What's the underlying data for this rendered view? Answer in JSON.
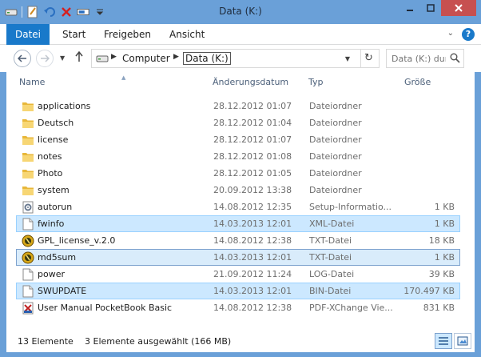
{
  "window": {
    "title": "Data (K:)"
  },
  "ribbon": {
    "tabs": [
      {
        "label": "Datei"
      },
      {
        "label": "Start"
      },
      {
        "label": "Freigeben"
      },
      {
        "label": "Ansicht"
      }
    ],
    "help": "?"
  },
  "address": {
    "crumbs": [
      "Computer",
      "Data (K:)"
    ],
    "search_placeholder": "Data (K:) durc..."
  },
  "columns": {
    "name": "Name",
    "date": "Änderungsdatum",
    "type": "Typ",
    "size": "Größe"
  },
  "files": [
    {
      "name": "applications",
      "date": "28.12.2012 01:07",
      "type": "Dateiordner",
      "size": "",
      "icon": "folder-icon",
      "selected": false
    },
    {
      "name": "Deutsch",
      "date": "28.12.2012 01:04",
      "type": "Dateiordner",
      "size": "",
      "icon": "folder-icon",
      "selected": false
    },
    {
      "name": "license",
      "date": "28.12.2012 01:07",
      "type": "Dateiordner",
      "size": "",
      "icon": "folder-icon",
      "selected": false
    },
    {
      "name": "notes",
      "date": "28.12.2012 01:08",
      "type": "Dateiordner",
      "size": "",
      "icon": "folder-icon",
      "selected": false
    },
    {
      "name": "Photo",
      "date": "28.12.2012 01:05",
      "type": "Dateiordner",
      "size": "",
      "icon": "folder-icon",
      "selected": false
    },
    {
      "name": "system",
      "date": "20.09.2012 13:38",
      "type": "Dateiordner",
      "size": "",
      "icon": "folder-icon",
      "selected": false
    },
    {
      "name": "autorun",
      "date": "14.08.2012 12:35",
      "type": "Setup-Informatio...",
      "size": "1 KB",
      "icon": "setup-file-icon",
      "selected": false
    },
    {
      "name": "fwinfo",
      "date": "14.03.2013 12:01",
      "type": "XML-Datei",
      "size": "1 KB",
      "icon": "document-icon",
      "selected": true
    },
    {
      "name": "GPL_license_v.2.0",
      "date": "14.08.2012 12:38",
      "type": "TXT-Datei",
      "size": "18 KB",
      "icon": "text-app-icon",
      "selected": false
    },
    {
      "name": "md5sum",
      "date": "14.03.2013 12:01",
      "type": "TXT-Datei",
      "size": "1 KB",
      "icon": "text-app-icon",
      "selected": true
    },
    {
      "name": "power",
      "date": "21.09.2012 11:24",
      "type": "LOG-Datei",
      "size": "39 KB",
      "icon": "document-icon",
      "selected": false
    },
    {
      "name": "SWUPDATE",
      "date": "14.03.2013 12:01",
      "type": "BIN-Datei",
      "size": "170.497 KB",
      "icon": "document-icon",
      "selected": true
    },
    {
      "name": "User Manual PocketBook Basic",
      "date": "14.08.2012 12:38",
      "type": "PDF-XChange Vie...",
      "size": "831 KB",
      "icon": "pdf-icon",
      "selected": false
    }
  ],
  "status": {
    "count": "13 Elemente",
    "selection": "3 Elemente ausgewählt (166 MB)"
  },
  "colors": {
    "accent": "#1979ca",
    "selection": "#cce8ff",
    "titlebar": "#6aa0d8",
    "close": "#c75050"
  }
}
